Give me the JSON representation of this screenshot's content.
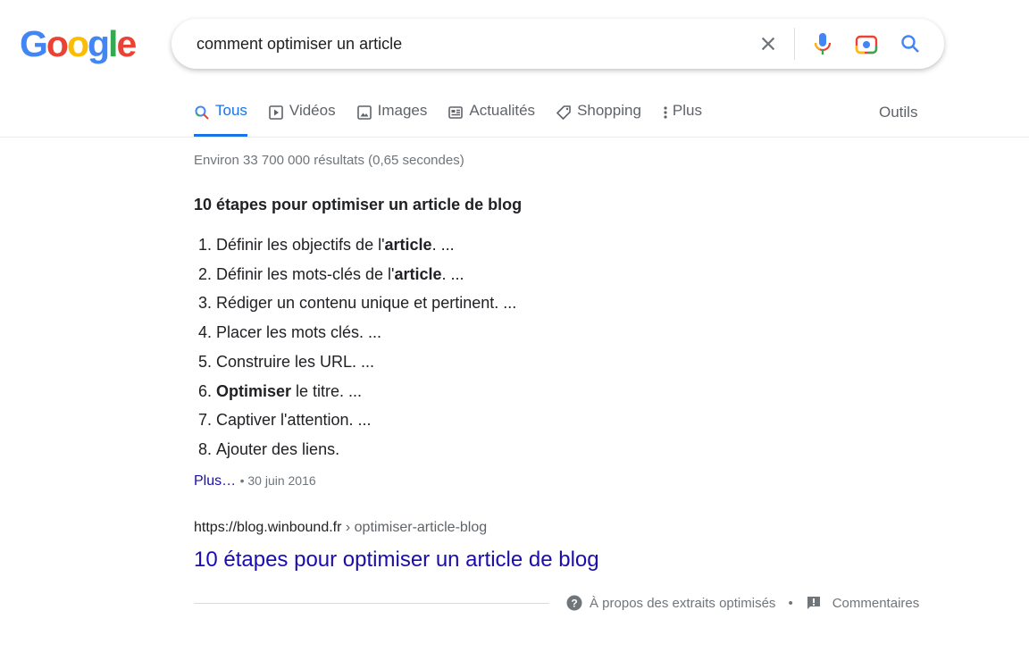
{
  "logo": {
    "letters": [
      "G",
      "o",
      "o",
      "g",
      "l",
      "e"
    ],
    "colors": [
      "#4285f4",
      "#ea4335",
      "#fbbc05",
      "#4285f4",
      "#34a853",
      "#ea4335"
    ]
  },
  "search": {
    "query": "comment optimiser un article",
    "icons": [
      "close-icon",
      "microphone-icon",
      "camera-lens-icon",
      "search-icon"
    ]
  },
  "tabs": [
    {
      "label": "Tous",
      "icon": "search-icon",
      "active": true
    },
    {
      "label": "Vidéos",
      "icon": "play-icon"
    },
    {
      "label": "Images",
      "icon": "image-icon"
    },
    {
      "label": "Actualités",
      "icon": "news-icon"
    },
    {
      "label": "Shopping",
      "icon": "tag-icon"
    },
    {
      "label": "Plus",
      "icon": "more-vert-icon"
    }
  ],
  "tools_label": "Outils",
  "result_stats": "Environ 33 700 000 résultats (0,65 secondes)",
  "snippet": {
    "title": "10 étapes pour optimiser un article de blog",
    "items": [
      [
        {
          "t": "Définir les objectifs de l'"
        },
        {
          "t": "article",
          "b": true
        },
        {
          "t": ". ..."
        }
      ],
      [
        {
          "t": "Définir les mots-clés de l'"
        },
        {
          "t": "article",
          "b": true
        },
        {
          "t": ". ..."
        }
      ],
      [
        {
          "t": "Rédiger un contenu unique et pertinent. ..."
        }
      ],
      [
        {
          "t": "Placer les mots clés. ..."
        }
      ],
      [
        {
          "t": "Construire les URL. ..."
        }
      ],
      [
        {
          "t": "Optimiser",
          "b": true
        },
        {
          "t": " le titre. ..."
        }
      ],
      [
        {
          "t": "Captiver l'attention. ..."
        }
      ],
      [
        {
          "t": "Ajouter des liens."
        }
      ]
    ],
    "more_label": "Plus…",
    "date": "30 juin 2016",
    "url_domain": "https://blog.winbound.fr",
    "url_path": " › optimiser-article-blog",
    "link_title": "10 étapes pour optimiser un article de blog"
  },
  "footer": {
    "about": "À propos des extraits optimisés",
    "feedback": "Commentaires"
  },
  "colors": {
    "accent": "#1a73e8",
    "link": "#1a0dab",
    "muted": "#70757a"
  }
}
